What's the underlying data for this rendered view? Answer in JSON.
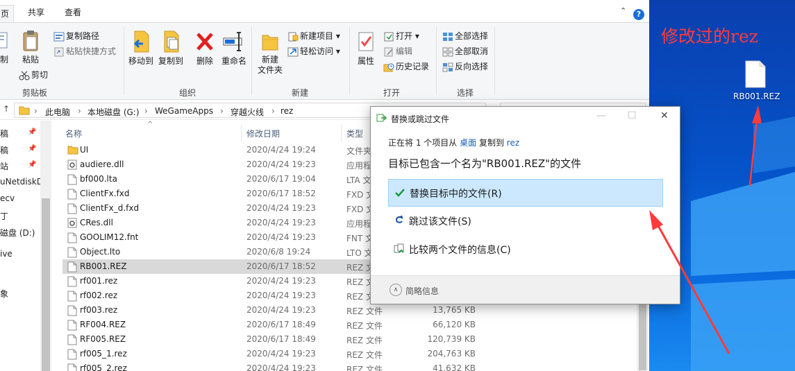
{
  "ribbon": {
    "tabs": [
      "页",
      "共享",
      "查看"
    ],
    "clipboard": {
      "partial1": "制",
      "paste": "粘贴",
      "copy_path": "复制路径",
      "paste_shortcut": "粘贴快捷方式",
      "cut": "剪切",
      "group": "剪贴板"
    },
    "organize": {
      "move_to": "移动到",
      "copy_to": "复制到",
      "delete": "删除",
      "rename": "重命名",
      "group": "组织"
    },
    "new": {
      "new_folder_l1": "新建",
      "new_folder_l2": "文件夹",
      "new_item": "新建项目",
      "easy_access": "轻松访问",
      "group": "新建"
    },
    "open": {
      "properties": "属性",
      "open": "打开",
      "edit": "编辑",
      "history": "历史记录",
      "group": "打开"
    },
    "select": {
      "select_all": "全部选择",
      "select_none": "全部取消",
      "invert": "反向选择",
      "group": "选择"
    }
  },
  "address": {
    "crumbs": [
      "此电脑",
      "本地磁盘 (G:)",
      "WeGameApps",
      "穿越火线",
      "rez"
    ]
  },
  "nav": {
    "items": [
      "稿",
      "站",
      "uNetdiskD",
      "ecv",
      "丁",
      "磁盘 (D:)",
      "ive",
      "象"
    ]
  },
  "columns": {
    "name": "名称",
    "date": "修改日期",
    "type": "类型"
  },
  "files": [
    {
      "name": "UI",
      "date": "2020/4/24 19:24",
      "type": "文件夹",
      "size": "",
      "icon": "folder"
    },
    {
      "name": "audiere.dll",
      "date": "2020/4/24 19:23",
      "type": "应用程",
      "size": "",
      "icon": "gear"
    },
    {
      "name": "bf000.lta",
      "date": "2020/6/17 19:04",
      "type": "LTA 文",
      "size": "",
      "icon": "doc"
    },
    {
      "name": "ClientFx.fxd",
      "date": "2020/6/17 18:52",
      "type": "FXD 文",
      "size": "",
      "icon": "doc"
    },
    {
      "name": "ClientFx_d.fxd",
      "date": "2020/4/24 19:23",
      "type": "FXD 文",
      "size": "",
      "icon": "doc"
    },
    {
      "name": "CRes.dll",
      "date": "2020/4/24 19:23",
      "type": "应用程",
      "size": "",
      "icon": "gear"
    },
    {
      "name": "GOOLIM12.fnt",
      "date": "2020/4/24 19:23",
      "type": "FNT 文",
      "size": "",
      "icon": "doc"
    },
    {
      "name": "Object.lto",
      "date": "2020/6/8 19:24",
      "type": "LTO 文",
      "size": "",
      "icon": "doc"
    },
    {
      "name": "RB001.REZ",
      "date": "2020/6/17 18:52",
      "type": "REZ 文",
      "size": "",
      "icon": "doc",
      "selected": true
    },
    {
      "name": "rf001.rez",
      "date": "2020/4/24 19:23",
      "type": "REZ 文",
      "size": "",
      "icon": "doc"
    },
    {
      "name": "rf002.rez",
      "date": "2020/4/24 19:23",
      "type": "REZ 文",
      "size": "",
      "icon": "doc"
    },
    {
      "name": "rf003.rez",
      "date": "2020/4/24 19:23",
      "type": "REZ 文件",
      "size": "13,765 KB",
      "icon": "doc"
    },
    {
      "name": "RF004.REZ",
      "date": "2020/6/17 18:49",
      "type": "REZ 文件",
      "size": "66,120 KB",
      "icon": "doc"
    },
    {
      "name": "RF005.REZ",
      "date": "2020/6/17 18:49",
      "type": "REZ 文件",
      "size": "120,739 KB",
      "icon": "doc"
    },
    {
      "name": "rf005_1.rez",
      "date": "2020/4/24 19:23",
      "type": "REZ 文件",
      "size": "204,763 KB",
      "icon": "doc"
    },
    {
      "name": "rf005_2.rez",
      "date": "2020/4/24 19:23",
      "type": "REZ 文件",
      "size": "41,632 KB",
      "icon": "doc"
    }
  ],
  "dialog": {
    "title": "替换或跳过文件",
    "line1_pre": "正在将 1 个项目从",
    "from": "桌面",
    "line1_mid": "复制到",
    "to": "rez",
    "heading": "目标已包含一个名为\"RB001.REZ\"的文件",
    "options": [
      "替换目标中的文件(R)",
      "跳过该文件(S)",
      "比较两个文件的信息(C)"
    ],
    "less_info": "简略信息",
    "close_glyph": "✕",
    "max_glyph": "☐",
    "min_glyph": "—"
  },
  "desktop": {
    "annotation": "修改过的rez",
    "file_label": "RB001.REZ"
  },
  "colors": {
    "accent": "#1a6ed8",
    "selection": "#cce8ff",
    "annotation": "#ff3b3b"
  }
}
